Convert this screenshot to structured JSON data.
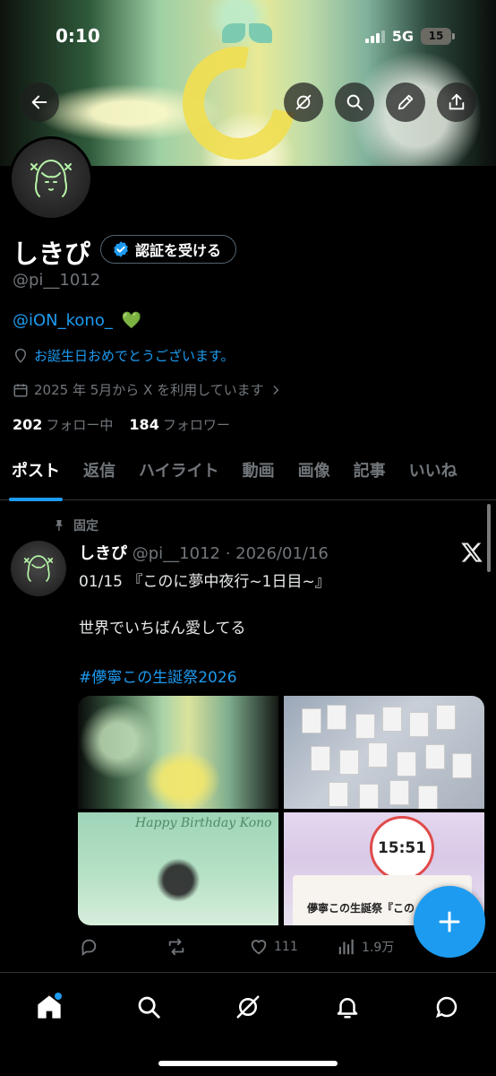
{
  "status_bar": {
    "time": "0:10",
    "network": "5G",
    "battery": "15"
  },
  "profile": {
    "name": "しきぴ",
    "verify_button": "認証を受ける",
    "handle": "@pi__1012",
    "bio_mention": "@iON_kono_",
    "bio_emoji": "💚",
    "location": "お誕生日おめでとうございます。",
    "joined": "2025 年 5月から X を利用しています",
    "following_count": "202",
    "following_label": "フォロー中",
    "followers_count": "184",
    "followers_label": "フォロワー"
  },
  "tabs": [
    "ポスト",
    "返信",
    "ハイライト",
    "動画",
    "画像",
    "記事",
    "いいね"
  ],
  "active_tab": "ポスト",
  "pinned_post": {
    "pinned_label": "固定",
    "author_name": "しきぴ",
    "author_handle_date": "@pi__1012 · 2026/01/16",
    "line1": "01/15 『このに夢中夜行~1日目~』",
    "line2": "世界でいちばん愛してる",
    "hashtag": "#儚寧この生誕祭2026",
    "media_text_3": "Happy Birthday Kono",
    "media_clock": "15:51",
    "media_caption_4": "儚寧この生誕祭『この",
    "likes": "111",
    "views": "1.9万"
  },
  "colors": {
    "accent": "#1d9bf0",
    "background": "#000000",
    "muted": "#71767b"
  }
}
